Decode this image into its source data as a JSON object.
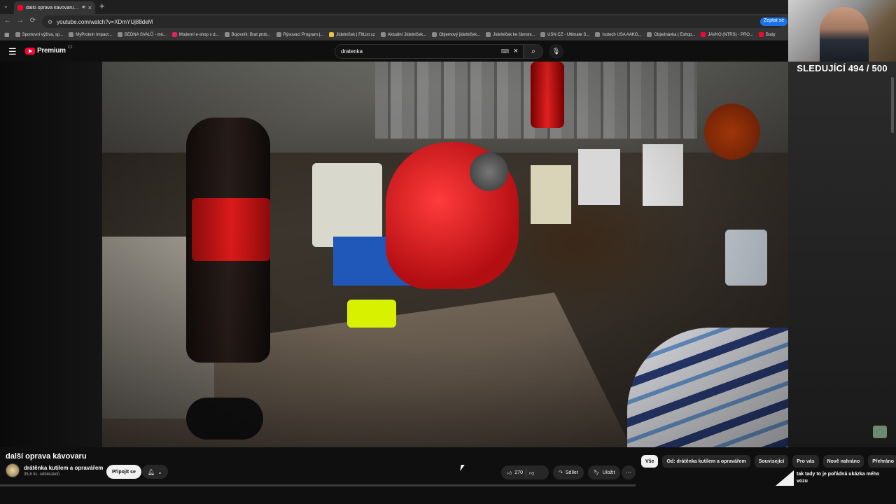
{
  "browser": {
    "tab_title": "další oprava kávovaru - Yo",
    "url": "youtube.com/watch?v=XDmYUj88deM",
    "ask_button": "Zeptat se",
    "bookmarks": [
      "Sportovní výživa, sp...",
      "MyProtein Impact...",
      "BEDNA SVALŮ - mé...",
      "Moderní e-shop s d...",
      "Bojovník: Brat prob...",
      "Rýsovací Program |...",
      "Jídelníček | FitList.cz",
      "Aktuální Jídelníček...",
      "Objemový jídelníček...",
      "Jídelníček ke členstv...",
      "USN CZ - Ultimate S...",
      "Isotech USA AAKG...",
      "Objednávka | Eshop...",
      "JAVKO (NTRS) - PRO...",
      "Body"
    ]
  },
  "youtube": {
    "brand": "Premium",
    "region": "CZ",
    "search_value": "dratenka"
  },
  "overlay": {
    "counter": "SLEDUJÍCÍ 494 / 500"
  },
  "video": {
    "title": "další oprava kávovaru",
    "channel": "drátěnka kutilem a opravářem",
    "subscribers": "35,6 tis. odběratelů",
    "subscribe_label": "Připojit se",
    "likes": "270",
    "share_label": "Sdílet",
    "save_label": "Uložit",
    "progress": 0.0
  },
  "chips": [
    "Vše",
    "Od: drátěnka kutilem a opravářem",
    "Související",
    "Pro vás",
    "Nově nahráno",
    "Přehráno"
  ],
  "recommended": {
    "title": "tak tady to je pořádná ukázka mého vozu"
  }
}
